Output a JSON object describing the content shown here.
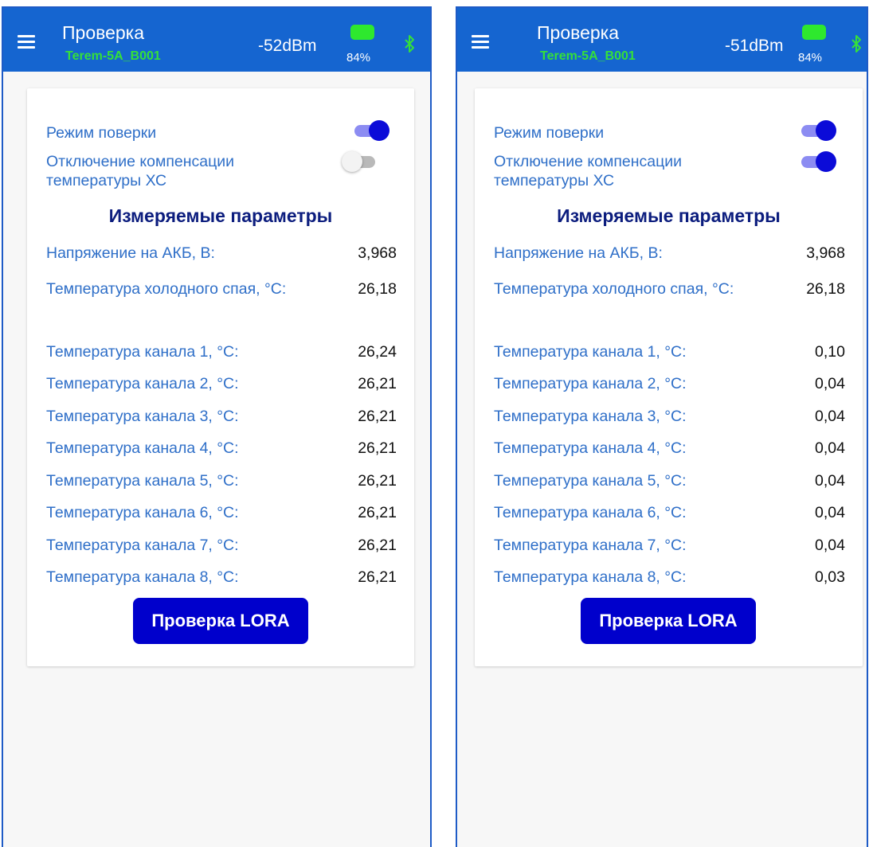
{
  "screens": [
    {
      "header": {
        "title": "Проверка",
        "device": "Terem-5A_B001",
        "rssi": "-52dBm",
        "battery": "84%"
      },
      "toggles": {
        "verification_label": "Режим поверки",
        "verification_on": true,
        "cjc_label_line1": "Отключение компенсации",
        "cjc_label_line2": "температуры ХС",
        "cjc_on": false
      },
      "section_title": "Измеряемые параметры",
      "battery_voltage": {
        "label": "Напряжение на АКБ, В:",
        "value": "3,968"
      },
      "cold_junction": {
        "label": "Температура холодного спая, °C:",
        "value": "26,18"
      },
      "channels": [
        {
          "label": "Температура канала 1, °C:",
          "value": "26,24"
        },
        {
          "label": "Температура канала 2, °C:",
          "value": "26,21"
        },
        {
          "label": "Температура канала 3, °C:",
          "value": "26,21"
        },
        {
          "label": "Температура канала 4, °C:",
          "value": "26,21"
        },
        {
          "label": "Температура канала 5, °C:",
          "value": "26,21"
        },
        {
          "label": "Температура канала 6, °C:",
          "value": "26,21"
        },
        {
          "label": "Температура канала 7, °C:",
          "value": "26,21"
        },
        {
          "label": "Температура канала 8, °C:",
          "value": "26,21"
        }
      ],
      "lora_button": "Проверка LORA"
    },
    {
      "header": {
        "title": "Проверка",
        "device": "Terem-5A_B001",
        "rssi": "-51dBm",
        "battery": "84%"
      },
      "toggles": {
        "verification_label": "Режим поверки",
        "verification_on": true,
        "cjc_label_line1": "Отключение компенсации",
        "cjc_label_line2": "температуры ХС",
        "cjc_on": true
      },
      "section_title": "Измеряемые параметры",
      "battery_voltage": {
        "label": "Напряжение на АКБ, В:",
        "value": "3,968"
      },
      "cold_junction": {
        "label": "Температура холодного спая, °C:",
        "value": "26,18"
      },
      "channels": [
        {
          "label": "Температура канала 1, °C:",
          "value": "0,10"
        },
        {
          "label": "Температура канала 2, °C:",
          "value": "0,04"
        },
        {
          "label": "Температура канала 3, °C:",
          "value": "0,04"
        },
        {
          "label": "Температура канала 4, °C:",
          "value": "0,04"
        },
        {
          "label": "Температура канала 5, °C:",
          "value": "0,04"
        },
        {
          "label": "Температура канала 6, °C:",
          "value": "0,04"
        },
        {
          "label": "Температура канала 7, °C:",
          "value": "0,04"
        },
        {
          "label": "Температура канала 8, °C:",
          "value": "0,03"
        }
      ],
      "lora_button": "Проверка LORA"
    }
  ],
  "colors": {
    "appbar": "#1565d0",
    "device_name": "#35e03a",
    "battery": "#2ee82e",
    "bluetooth": "#35e03a",
    "label_text": "#2f6fc8",
    "section_title": "#0c1d7e",
    "button": "#0000cc",
    "toggle_on": "#0b0bd8"
  },
  "icons": [
    "menu-icon",
    "battery-icon",
    "bluetooth-icon"
  ]
}
